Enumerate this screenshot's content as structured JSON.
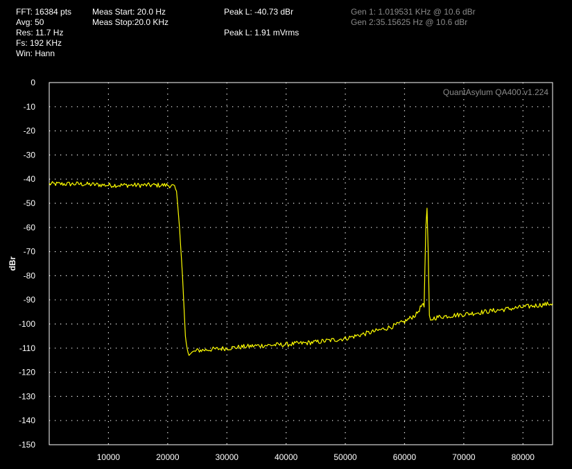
{
  "status": {
    "fft": "FFT: 16384 pts",
    "avg": "Avg: 50",
    "res": "Res: 11.7 Hz",
    "fs": "Fs: 192 KHz",
    "win": "Win: Hann",
    "meas_start": "Meas Start: 20.0 Hz",
    "meas_stop": "Meas Stop:20.0 KHz",
    "peak_dbr": "Peak L: -40.73 dBr",
    "peak_vrms": "Peak L: 1.91 mVrms",
    "gen1": "Gen 1: 1.019531 KHz @ 10.6  dBr",
    "gen2": "Gen 2:35.15625 Hz @ 10.6  dBr"
  },
  "watermark": "QuantAsylum QA400 v1.224",
  "chart_data": {
    "type": "line",
    "title": "",
    "xlabel": "",
    "ylabel": "dBr",
    "xlim": [
      0,
      85000
    ],
    "ylim": [
      -150,
      0
    ],
    "xticks": [
      10000,
      20000,
      30000,
      40000,
      50000,
      60000,
      70000,
      80000
    ],
    "yticks": [
      0,
      -10,
      -20,
      -30,
      -40,
      -50,
      -60,
      -70,
      -80,
      -90,
      -100,
      -110,
      -120,
      -130,
      -140,
      -150
    ],
    "grid": true,
    "colors": {
      "trace": "#ffff00",
      "background": "#000000",
      "grid": "#ffffff",
      "axis": "#ffffff"
    },
    "series": [
      {
        "x": [
          0,
          5000,
          10000,
          15000,
          20000,
          21000,
          21500,
          22000,
          22500,
          23000,
          23300,
          23600,
          24000,
          25000,
          30000,
          35000,
          40000,
          45000,
          50000,
          55000,
          58000,
          60000,
          62000,
          63000,
          63300,
          63600,
          63800,
          64000,
          64200,
          64400,
          64600,
          65000,
          66000,
          70000,
          75000,
          80000,
          85000
        ],
        "y": [
          -42,
          -42,
          -42.5,
          -42.5,
          -42.5,
          -43,
          -45,
          -60,
          -80,
          -105,
          -111,
          -112,
          -112,
          -111,
          -110,
          -109,
          -108.5,
          -107.5,
          -106,
          -103,
          -101,
          -99,
          -96,
          -92,
          -93,
          -60,
          -52,
          -70,
          -97,
          -99,
          -98,
          -97.5,
          -97,
          -96,
          -94.5,
          -93,
          -91.5
        ]
      }
    ]
  }
}
